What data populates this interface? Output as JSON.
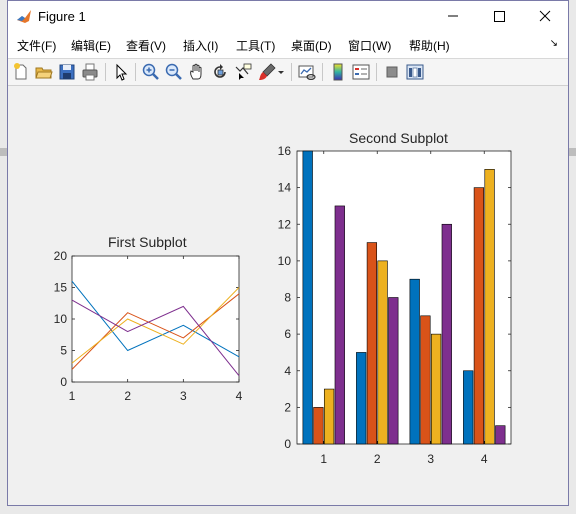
{
  "window": {
    "title": "Figure 1"
  },
  "menu": {
    "items": [
      "文件(F)",
      "编辑(E)",
      "查看(V)",
      "插入(I)",
      "工具(T)",
      "桌面(D)",
      "窗口(W)",
      "帮助(H)"
    ]
  },
  "toolbar": {
    "icons": [
      "new-figure-icon",
      "open-file-icon",
      "save-icon",
      "print-icon",
      "select-arrow-icon",
      "zoom-in-icon",
      "zoom-out-icon",
      "pan-hand-icon",
      "rotate-3d-icon",
      "data-cursor-icon",
      "brush-icon",
      "link-plot-icon",
      "colorbar-icon",
      "legend-icon",
      "hide-plot-tools-icon",
      "show-plot-tools-icon"
    ]
  },
  "chart_data": [
    {
      "type": "line",
      "title": "First Subplot",
      "x": [
        1,
        2,
        3,
        4
      ],
      "xlim": [
        1,
        4
      ],
      "ylim": [
        0,
        20
      ],
      "xticks": [
        1,
        2,
        3,
        4
      ],
      "yticks": [
        0,
        5,
        10,
        15,
        20
      ],
      "series": [
        {
          "values": [
            16,
            5,
            9,
            4
          ],
          "color": "#0072BD"
        },
        {
          "values": [
            2,
            11,
            7,
            14
          ],
          "color": "#D95319"
        },
        {
          "values": [
            3,
            10,
            6,
            15
          ],
          "color": "#EDB120"
        },
        {
          "values": [
            13,
            8,
            12,
            1
          ],
          "color": "#7E2F8E"
        }
      ]
    },
    {
      "type": "bar",
      "title": "Second Subplot",
      "categories": [
        "1",
        "2",
        "3",
        "4"
      ],
      "ylim": [
        0,
        16
      ],
      "yticks": [
        0,
        2,
        4,
        6,
        8,
        10,
        12,
        14,
        16
      ],
      "series": [
        {
          "values": [
            16,
            5,
            9,
            4
          ],
          "color": "#0072BD"
        },
        {
          "values": [
            2,
            11,
            7,
            14
          ],
          "color": "#D95319"
        },
        {
          "values": [
            3,
            10,
            6,
            15
          ],
          "color": "#EDB120"
        },
        {
          "values": [
            13,
            8,
            12,
            1
          ],
          "color": "#7E2F8E"
        }
      ]
    }
  ]
}
